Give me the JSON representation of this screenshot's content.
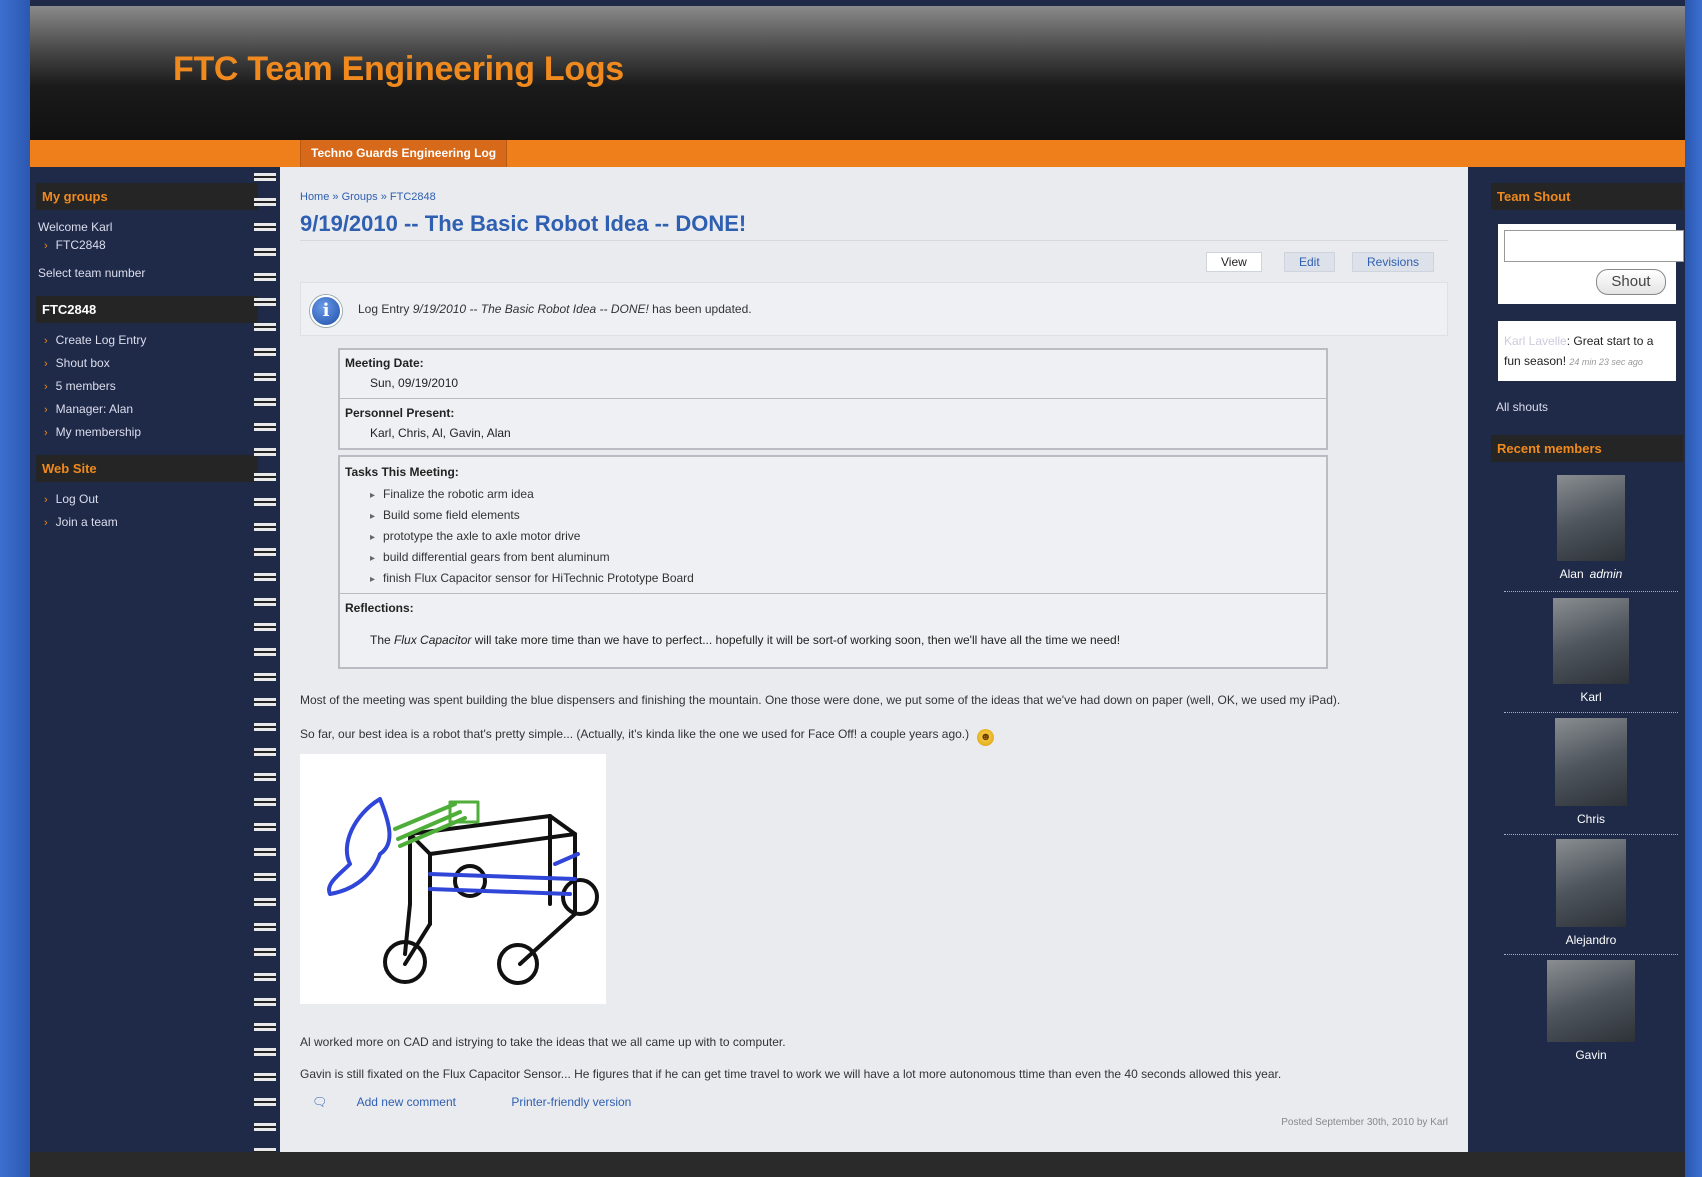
{
  "site": {
    "title": "FTC Team Engineering Logs"
  },
  "nav": {
    "primary_tab": "Techno Guards Engineering Log"
  },
  "sidebar_left": {
    "my_groups": {
      "title": "My groups",
      "welcome": "Welcome Karl",
      "groups": [
        "FTC2848"
      ],
      "select_team": "Select team number"
    },
    "group_menu": {
      "title": "FTC2848",
      "items": [
        "Create Log Entry",
        "Shout box",
        "5 members",
        "Manager: Alan",
        "My membership"
      ]
    },
    "website": {
      "title": "Web Site",
      "items": [
        "Log Out",
        "Join a team"
      ]
    }
  },
  "content": {
    "breadcrumb": "Home » Groups » FTC2848",
    "title": "9/19/2010 -- The Basic Robot Idea -- DONE!",
    "tabs": [
      "View",
      "Edit",
      "Revisions"
    ],
    "status": {
      "icon": "info-icon",
      "prefix": "Log Entry",
      "entry": "9/19/2010 -- The Basic Robot Idea -- DONE!",
      "suffix": "has been updated."
    },
    "meeting_date": {
      "label": "Meeting Date:",
      "value": "Sun, 09/19/2010"
    },
    "personnel": {
      "label": "Personnel Present:",
      "value": "Karl, Chris, Al, Gavin, Alan"
    },
    "tasks": {
      "label": "Tasks This Meeting:",
      "items": [
        "Finalize the robotic arm idea",
        "Build some field elements",
        "prototype the axle to axle motor drive",
        "build differential gears from bent aluminum",
        "finish Flux Capacitor sensor for HiTechnic Prototype Board"
      ]
    },
    "reflections": {
      "label": "Reflections:",
      "pre": "The",
      "em": "Flux Capacitor",
      "post": "will take more time than we have to perfect... hopefully it will be sort-of working soon, then we'll have all the time we need!"
    },
    "paragraphs": [
      "Most of the meeting was spent building the blue dispensers and finishing the mountain. One those were done, we put some of the ideas that we've had down on paper (well, OK, we used my iPad).",
      "So far, our best idea is a robot that's pretty simple... (Actually, it's kinda like the one we used for Face Off! a couple years ago.)",
      "Al worked more on CAD and istrying to take the ideas that we all came up with to computer.",
      "Gavin is still fixated on the Flux Capacitor Sensor... He figures that if he can get time travel to work we will have a lot more autonomous ttime than even the 40 seconds allowed this year."
    ],
    "links": [
      "Add new comment",
      "Printer-friendly version"
    ],
    "posted": "Posted September 30th, 2010 by Karl"
  },
  "sidebar_right": {
    "shout": {
      "title": "Team Shout",
      "button": "Shout",
      "entry_user": "Karl Lavelle",
      "entry_text": ": Great start to a fun season!",
      "entry_time": "24 min 23 sec ago",
      "all_link": "All shouts"
    },
    "recent": {
      "title": "Recent members",
      "members": [
        {
          "name": "Alan",
          "role": "admin"
        },
        {
          "name": "Karl",
          "role": ""
        },
        {
          "name": "Chris",
          "role": ""
        },
        {
          "name": "Alejandro",
          "role": ""
        },
        {
          "name": "Gavin",
          "role": ""
        }
      ]
    }
  },
  "colors": {
    "accent_orange": "#ee7f1b",
    "title_orange": "#f08a1e",
    "link_blue": "#2f5fb0",
    "page_navy": "#1e2a48"
  }
}
